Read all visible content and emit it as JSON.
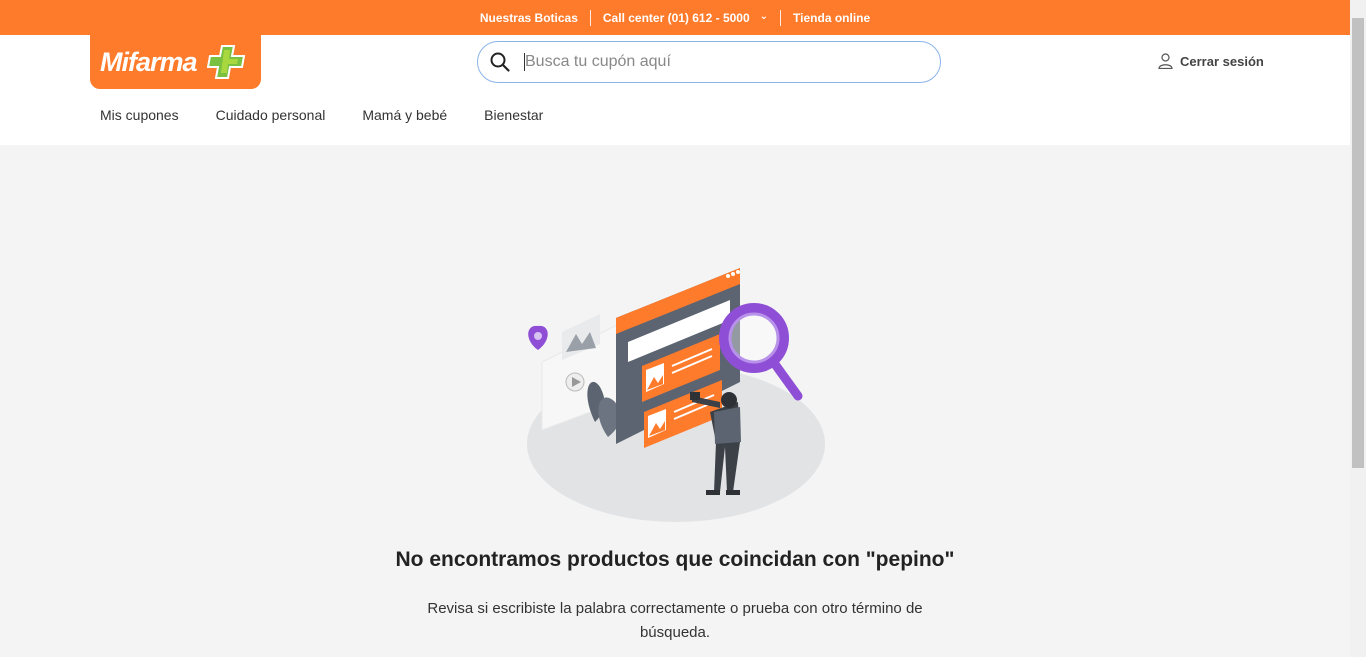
{
  "topbar": {
    "links": [
      "Nuestras Boticas",
      "Call center (01) 612 - 5000",
      "Tienda online"
    ]
  },
  "header": {
    "logo_text": "Mifarma",
    "search_placeholder": "Busca tu cupón aquí",
    "logout_label": "Cerrar sesión"
  },
  "nav": {
    "items": [
      "Mis cupones",
      "Cuidado personal",
      "Mamá y bebé",
      "Bienestar"
    ]
  },
  "empty_state": {
    "title": "No encontramos productos que coincidan con \"pepino\"",
    "description": "Revisa si escribiste la palabra correctamente o prueba con otro término de búsqueda."
  },
  "colors": {
    "brand_orange": "#ff7b2c",
    "brand_green": "#7ac142",
    "accent_purple": "#8e4fd6"
  }
}
